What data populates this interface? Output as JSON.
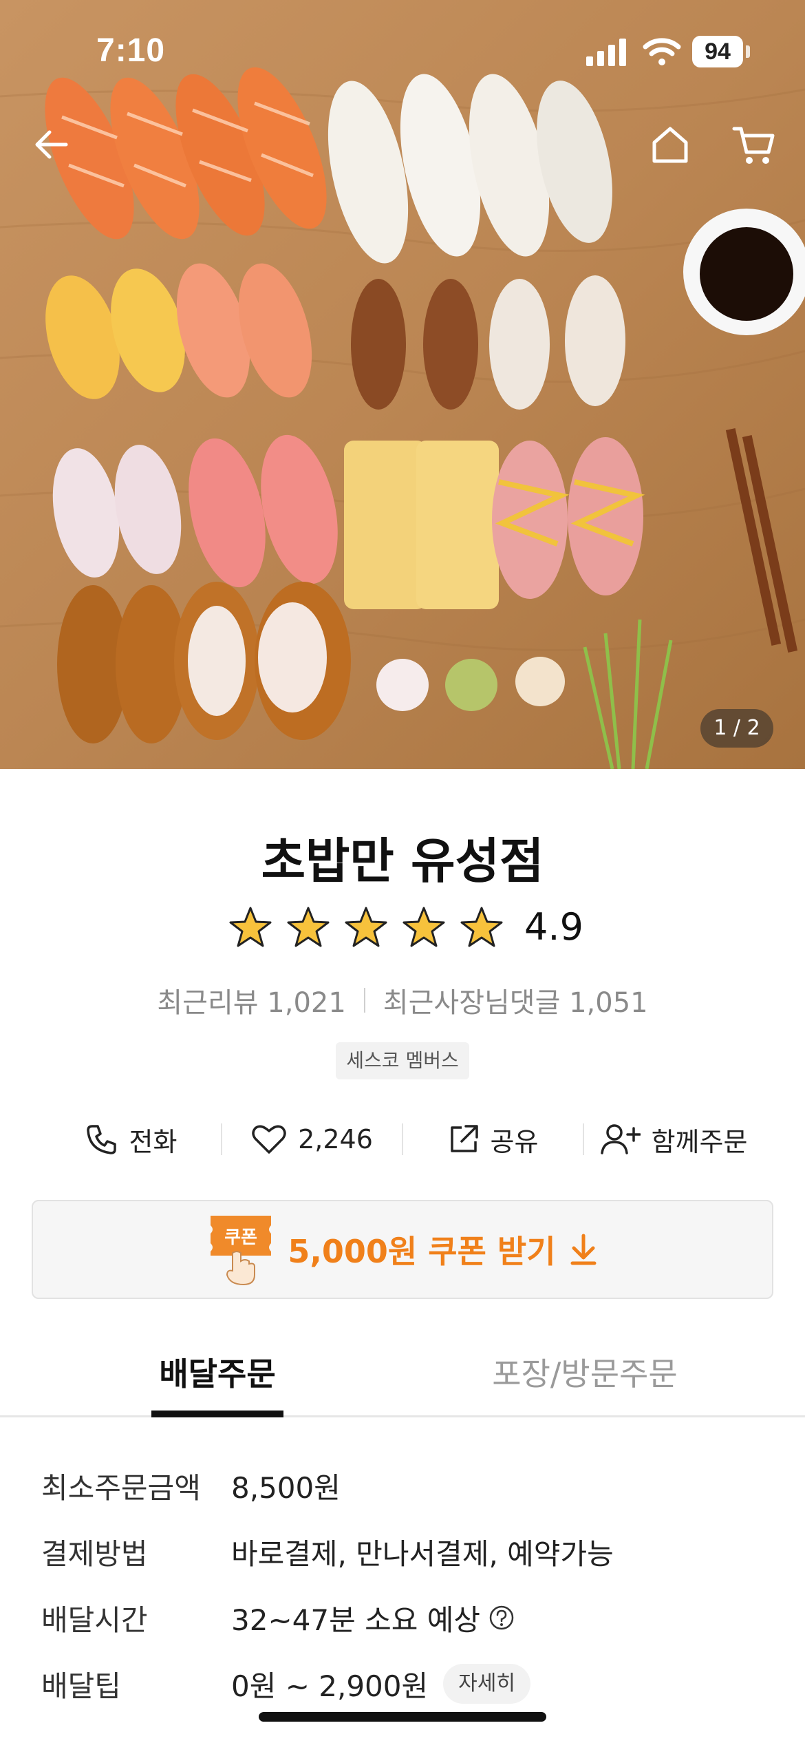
{
  "status_bar": {
    "time": "7:10",
    "battery": "94"
  },
  "hero": {
    "pager": "1 / 2"
  },
  "store": {
    "name": "초밥만 유성점",
    "rating": "4.9",
    "stars": 5,
    "recent_reviews": "최근리뷰 1,021",
    "owner_replies": "최근사장님댓글 1,051",
    "badge": "세스코 멤버스"
  },
  "actions": {
    "call": "전화",
    "likes": "2,246",
    "share": "공유",
    "group_order": "함께주문"
  },
  "coupon": {
    "tag": "쿠폰",
    "label": "5,000원 쿠폰 받기",
    "accent": "#f0801a"
  },
  "tabs": {
    "delivery": "배달주문",
    "pickup": "포장/방문주문"
  },
  "info": {
    "min_order_key": "최소주문금액",
    "min_order_value": "8,500원",
    "payment_key": "결제방법",
    "payment_value": "바로결제, 만나서결제, 예약가능",
    "time_key": "배달시간",
    "time_value": "32~47분 소요 예상",
    "tip_key": "배달팁",
    "tip_value": "0원 ~ 2,900원",
    "detail_button": "자세히"
  },
  "icons": [
    "back-arrow-icon",
    "home-icon",
    "cart-icon",
    "star-icon",
    "phone-icon",
    "heart-icon",
    "share-icon",
    "add-user-icon",
    "download-arrow-icon",
    "help-icon"
  ]
}
